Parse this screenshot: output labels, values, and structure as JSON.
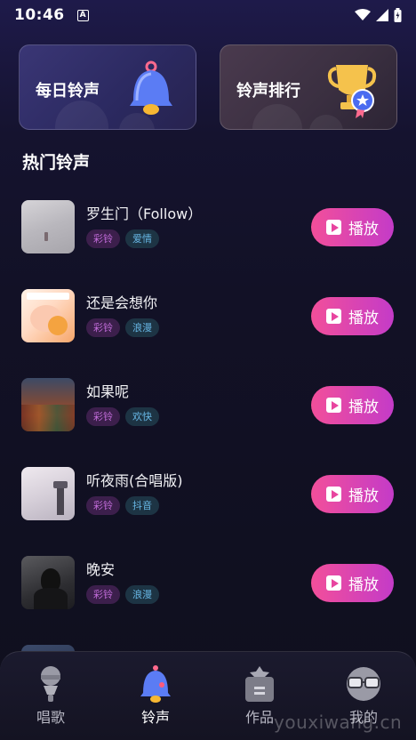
{
  "status_bar": {
    "time": "10:46",
    "a_badge": "A"
  },
  "cards": [
    {
      "label": "每日铃声",
      "icon": "bell-icon",
      "color": "#3a3675"
    },
    {
      "label": "铃声排行",
      "icon": "trophy-icon",
      "color": "#4a3a4e"
    }
  ],
  "section_title": "热门铃声",
  "play_label": "播放",
  "songs": [
    {
      "title": "罗生门（Follow）",
      "tags": [
        "彩铃",
        "爱情"
      ]
    },
    {
      "title": "还是会想你",
      "tags": [
        "彩铃",
        "浪漫"
      ]
    },
    {
      "title": "如果呢",
      "tags": [
        "彩铃",
        "欢快"
      ]
    },
    {
      "title": "听夜雨(合唱版)",
      "tags": [
        "彩铃",
        "抖音"
      ]
    },
    {
      "title": "晚安",
      "tags": [
        "彩铃",
        "浪漫"
      ]
    }
  ],
  "tabbar": [
    {
      "label": "唱歌",
      "icon": "microphone-icon",
      "active": false
    },
    {
      "label": "铃声",
      "icon": "bell-icon",
      "active": true
    },
    {
      "label": "作品",
      "icon": "folder-icon",
      "active": false
    },
    {
      "label": "我的",
      "icon": "avatar-glasses-icon",
      "active": false
    }
  ],
  "watermark": "youxiwang.cn",
  "colors": {
    "accent_start": "#f24f9a",
    "accent_end": "#c43bc8",
    "tag_purple": "#c06bd8",
    "tag_blue": "#67b6e4"
  }
}
